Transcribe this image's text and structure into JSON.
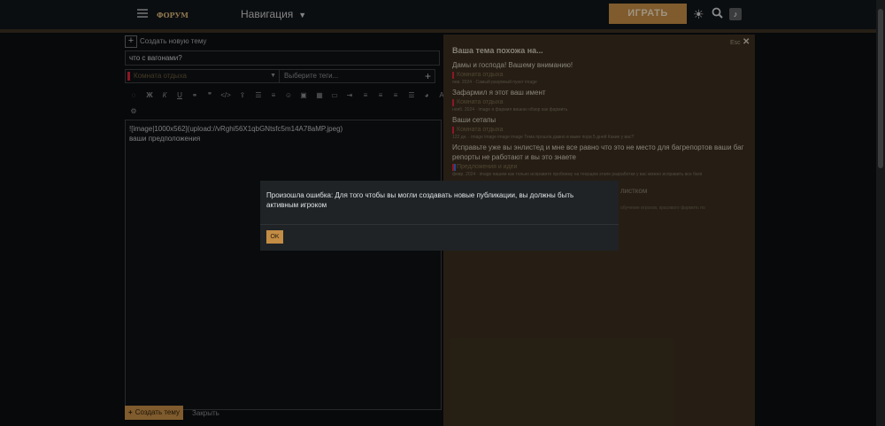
{
  "header": {
    "logo_text": "ФОРУМ",
    "nav_label": "Навигация",
    "play_label": "ИГРАТЬ",
    "icons": [
      "menu-icon",
      "sun-icon",
      "search-icon",
      "user-avatar-icon"
    ]
  },
  "composer": {
    "create_new_topic": "Создать новую тему",
    "title_value": "что с вагонами?",
    "category_placeholder": "Комната отдыха",
    "tags_placeholder": "Выберите теги...",
    "editor_lines": [
      "![image|1000x562](upload://vRghi56X1qbGNtsfc5m14A78aMP.jpeg)",
      "ваши предположения"
    ],
    "create_button": "Создать тему",
    "close_link": "Закрыть"
  },
  "similar": {
    "heading": "Ваша тема похожа на...",
    "esc_label": "Esc",
    "threads": [
      {
        "title": "Дамы и господа! Вашему вниманию!",
        "category": "Комната отдыха",
        "meta": "янв. 2024 · Самый разумный пункт image"
      },
      {
        "title": "Зафармил я этот ваш имент",
        "category": "Комната отдыха",
        "meta": "нояб. 2024 · image я фармил вишню обзор как фармить"
      },
      {
        "title": "Ваши сетапы",
        "category": "Комната отдыха",
        "meta": "122 дн. · image image image image Тема прошла давно в мыке пора 5 дней Какие у вас?"
      },
      {
        "title": "Исправьте уже вы энлистед и мне все равно что это не место для багрепортов ваши баг репорты не работают и вы это знаете",
        "category": "Предложения и идеи",
        "meta": "февр. 2024 · image пишем как только исправите проблему на текущем этапе разработки у вас можно исправить все баги"
      }
    ],
    "partial_title": "листком",
    "partial_meta": "обучение игроков, красивого фармить по"
  },
  "modal": {
    "message": "Произошла ошибка: Для того чтобы вы могли создавать новые публикации, вы должны быть активным игроком",
    "ok_label": "OK"
  },
  "colors": {
    "accent": "#c38d45",
    "category_red": "#d6243a",
    "panel_brown": "#3b2f1f"
  }
}
